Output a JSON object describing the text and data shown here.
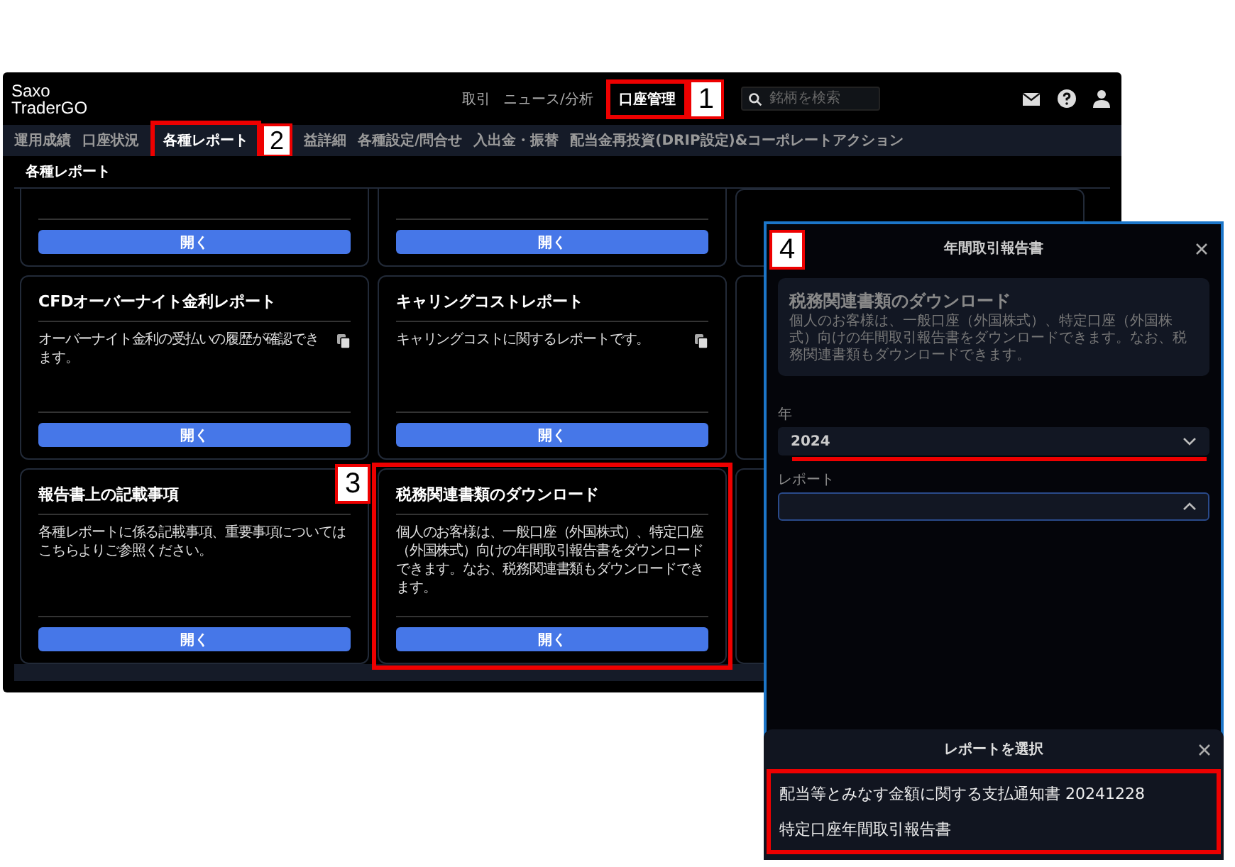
{
  "app": {
    "logo": "Saxo TraderGO",
    "nav": [
      {
        "label": "取引",
        "selected": false
      },
      {
        "label": "ニュース/分析",
        "selected": false
      },
      {
        "label": "口座管理",
        "selected": true,
        "callout": "1"
      }
    ],
    "search": {
      "placeholder": "銘柄を検索"
    },
    "subtabs": [
      {
        "label": "運用成績",
        "selected": false
      },
      {
        "label": "口座状況",
        "selected": false
      },
      {
        "label": "各種レポート",
        "selected": true,
        "callout": "2"
      },
      {
        "label": "益詳細",
        "selected": false
      },
      {
        "label": "各種設定/問合せ",
        "selected": false
      },
      {
        "label": "入出金・振替",
        "selected": false
      },
      {
        "label": "配当金再投資(DRIP設定)&コーポレートアクション",
        "selected": false
      }
    ],
    "panel_title": "各種レポート",
    "cards": [
      {
        "kind": "cut",
        "button": "開く"
      },
      {
        "kind": "cut",
        "button": "開く"
      },
      {
        "kind": "hidden"
      },
      {
        "kind": "full",
        "title": "CFDオーバーナイト金利レポート",
        "description": "オーバーナイト金利の受払いの履歴が確認できます。",
        "copy_icon": true,
        "button": "開く"
      },
      {
        "kind": "full",
        "title": "キャリングコストレポート",
        "description": "キャリングコストに関するレポートです。",
        "copy_icon": true,
        "button": "開く"
      },
      {
        "kind": "hidden"
      },
      {
        "kind": "full",
        "title": "報告書上の記載事項",
        "description": "各種レポートに係る記載事項、重要事項についてはこちらよりご参照ください。",
        "copy_icon": false,
        "button": "開く"
      },
      {
        "kind": "full",
        "title": "税務関連書類のダウンロード",
        "description": "個人のお客様は、一般口座（外国株式）、特定口座（外国株式）向けの年間取引報告書をダウンロードできます。なお、税務関連書類もダウンロードできます。",
        "copy_icon": false,
        "button": "開く",
        "callout": "3"
      },
      {
        "kind": "hidden"
      }
    ]
  },
  "dialog": {
    "title": "年間取引報告書",
    "callout": "4",
    "info": {
      "title": "税務関連書類のダウンロード",
      "text": "個人のお客様は、一般口座（外国株式）、特定口座（外国株式）向けの年間取引報告書をダウンロードできます。なお、税務関連書類もダウンロードできます。"
    },
    "fields": [
      {
        "label": "年",
        "value": "2024",
        "expanded": false,
        "highlighted": true
      },
      {
        "label": "レポート",
        "expanded": true,
        "highlighted": false
      }
    ],
    "sheet": {
      "title": "レポートを選択",
      "options": [
        "配当等とみなす金額に関する支払通知書 20241228",
        "特定口座年間取引報告書"
      ]
    }
  }
}
